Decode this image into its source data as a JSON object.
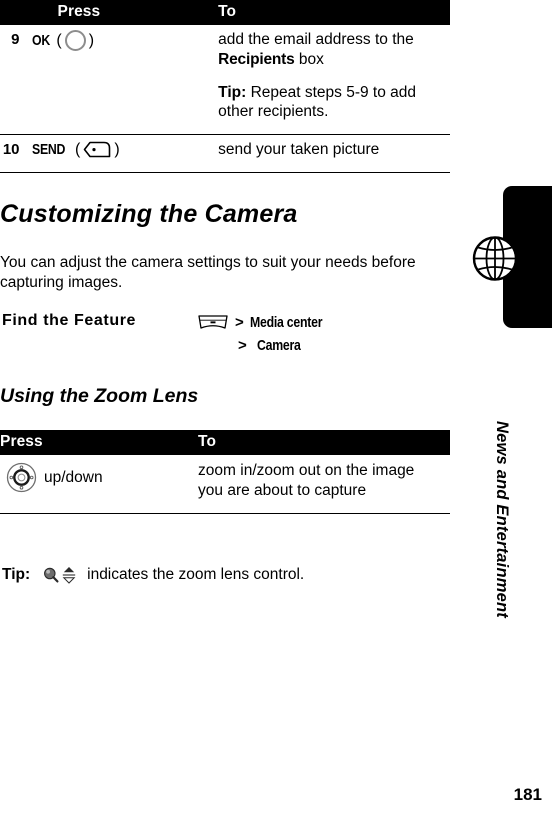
{
  "page": {
    "number": "181",
    "sidebar_chapter": "News and Entertainment",
    "sidebar_icon": "globe-icon"
  },
  "table_one": {
    "headers": {
      "press": "Press",
      "to": "To"
    },
    "rows": [
      {
        "step": "9",
        "press_key": "OK",
        "press_icon": "ok-key-ring-icon",
        "to_paragraphs": [
          {
            "pre": "add the email address to the ",
            "key": "Recipients",
            "post": " box"
          },
          {
            "lead": "Tip:",
            "text": " Repeat steps 5-9 to add other recipients."
          }
        ]
      },
      {
        "step": "10",
        "press_key": "SEND",
        "press_icon": "send-key-icon",
        "to_paragraphs": [
          {
            "pre": "send your taken picture",
            "key": "",
            "post": ""
          }
        ]
      }
    ]
  },
  "section": {
    "title": "Customizing the Camera",
    "intro": "You can adjust the camera settings to suit your needs before capturing images."
  },
  "find_the_feature": {
    "label": "Find the Feature",
    "menu_icon": "menu-key-icon",
    "separator": ">",
    "path": [
      "Media center",
      "Camera"
    ]
  },
  "subsection": {
    "title": "Using the Zoom Lens"
  },
  "table_two": {
    "headers": {
      "press": "Press",
      "to": "To"
    },
    "rows": [
      {
        "press_icon": "navigation-key-icon",
        "press_label": "up/down",
        "to_text": "zoom in/zoom out on the image you are about to capture"
      }
    ]
  },
  "tip": {
    "lead": "Tip:",
    "icons": [
      "zoom-magnifier-icon",
      "up-down-arrow-icon"
    ],
    "text": "indicates the zoom lens control."
  },
  "colors": {
    "header_bar": "#000000",
    "header_text": "#ffffff",
    "body_text": "#000000",
    "key_outline_gray": "#8d8d8d"
  }
}
